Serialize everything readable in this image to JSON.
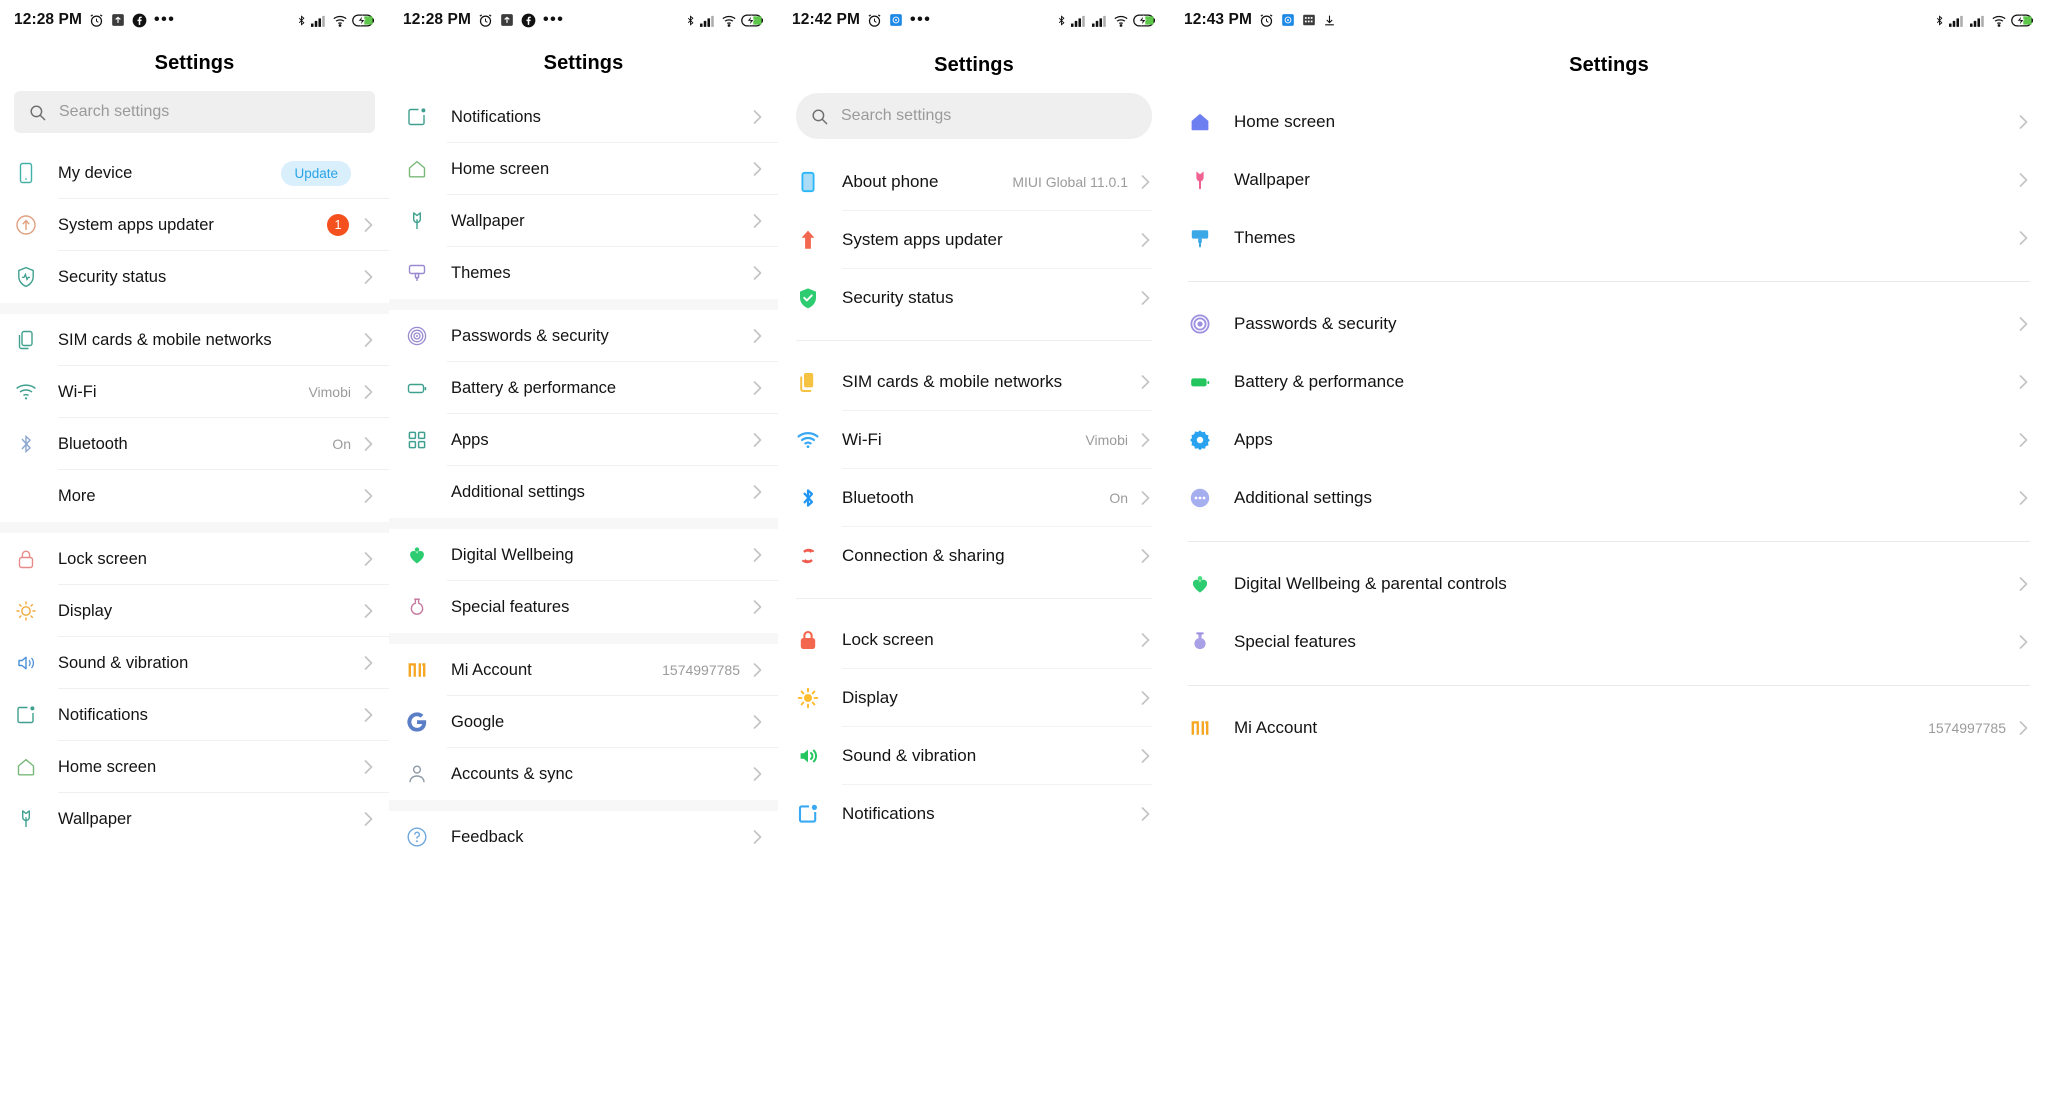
{
  "panels": [
    {
      "status": {
        "time": "12:28 PM",
        "left_icons": [
          "alarm-icon",
          "upload-box-icon",
          "facebook-icon",
          "more-dots-icon"
        ],
        "right_icons": [
          "bluetooth-icon",
          "signal-icon",
          "wifi-icon",
          "battery-charging-icon"
        ]
      },
      "title": "Settings",
      "search": {
        "placeholder": "Search settings",
        "icon": "search-icon",
        "style": "square"
      },
      "groups": [
        {
          "items": [
            {
              "label": "My device",
              "icon": "phone-outline-icon",
              "badge": "Update",
              "badge_type": "pill",
              "value": "",
              "chevron": false
            },
            {
              "label": "System apps updater",
              "icon": "update-circle-icon",
              "badge": "1",
              "badge_type": "count",
              "value": "",
              "chevron": true
            },
            {
              "label": "Security status",
              "icon": "shield-pulse-icon",
              "value": "",
              "chevron": true
            }
          ]
        },
        {
          "items": [
            {
              "label": "SIM cards & mobile networks",
              "icon": "sim-cards-icon",
              "value": "",
              "chevron": true
            },
            {
              "label": "Wi-Fi",
              "icon": "wifi-outline-icon",
              "value": "Vimobi",
              "chevron": true
            },
            {
              "label": "Bluetooth",
              "icon": "bluetooth-outline-icon",
              "value": "On",
              "chevron": true
            },
            {
              "label": "More",
              "icon": "more-dots-icon",
              "value": "",
              "chevron": true
            }
          ]
        },
        {
          "items": [
            {
              "label": "Lock screen",
              "icon": "lock-outline-icon",
              "value": "",
              "chevron": true
            },
            {
              "label": "Display",
              "icon": "display-sun-icon",
              "value": "",
              "chevron": true
            },
            {
              "label": "Sound & vibration",
              "icon": "sound-outline-icon",
              "value": "",
              "chevron": true
            },
            {
              "label": "Notifications",
              "icon": "notification-outline-icon",
              "value": "",
              "chevron": true
            },
            {
              "label": "Home screen",
              "icon": "home-outline-icon",
              "value": "",
              "chevron": true
            },
            {
              "label": "Wallpaper",
              "icon": "wallpaper-tulip-icon",
              "value": "",
              "chevron": true
            }
          ]
        }
      ]
    },
    {
      "status": {
        "time": "12:28 PM",
        "left_icons": [
          "alarm-icon",
          "upload-box-icon",
          "facebook-icon",
          "more-dots-icon"
        ],
        "right_icons": [
          "bluetooth-icon",
          "signal-icon",
          "wifi-icon",
          "battery-charging-icon"
        ]
      },
      "title": "Settings",
      "groups": [
        {
          "items": [
            {
              "label": "Notifications",
              "icon": "notification-outline-icon",
              "value": "",
              "chevron": true
            },
            {
              "label": "Home screen",
              "icon": "home-outline-icon",
              "value": "",
              "chevron": true
            },
            {
              "label": "Wallpaper",
              "icon": "wallpaper-tulip-icon",
              "value": "",
              "chevron": true
            },
            {
              "label": "Themes",
              "icon": "themes-brush-icon",
              "value": "",
              "chevron": true
            }
          ]
        },
        {
          "items": [
            {
              "label": "Passwords & security",
              "icon": "fingerprint-icon",
              "value": "",
              "chevron": true
            },
            {
              "label": "Battery & performance",
              "icon": "battery-outline-icon",
              "value": "",
              "chevron": true
            },
            {
              "label": "Apps",
              "icon": "apps-grid-icon",
              "value": "",
              "chevron": true
            },
            {
              "label": "Additional settings",
              "icon": "more-dots-icon",
              "value": "",
              "chevron": true
            }
          ]
        },
        {
          "items": [
            {
              "label": "Digital Wellbeing",
              "icon": "wellbeing-heart-icon",
              "value": "",
              "chevron": true
            },
            {
              "label": "Special features",
              "icon": "special-flask-icon",
              "value": "",
              "chevron": true
            }
          ]
        },
        {
          "items": [
            {
              "label": "Mi Account",
              "icon": "mi-logo-icon",
              "value": "1574997785",
              "chevron": true
            },
            {
              "label": "Google",
              "icon": "google-g-icon",
              "value": "",
              "chevron": true
            },
            {
              "label": "Accounts & sync",
              "icon": "account-person-icon",
              "value": "",
              "chevron": true
            }
          ]
        },
        {
          "items": [
            {
              "label": "Feedback",
              "icon": "feedback-question-icon",
              "value": "",
              "chevron": true
            }
          ]
        }
      ]
    },
    {
      "status": {
        "time": "12:42 PM",
        "left_icons": [
          "alarm-icon",
          "calendar-blue-icon",
          "more-dots-icon"
        ],
        "right_icons": [
          "bluetooth-icon",
          "signal-icon",
          "signal2-icon",
          "wifi-icon",
          "battery-charging-icon"
        ]
      },
      "title": "Settings",
      "search": {
        "placeholder": "Search settings",
        "icon": "search-icon",
        "style": "round"
      },
      "groups": [
        {
          "items": [
            {
              "label": "About phone",
              "icon": "about-phone-icon",
              "value": "MIUI Global 11.0.1",
              "chevron": true
            },
            {
              "label": "System apps updater",
              "icon": "arrow-up-red-icon",
              "value": "",
              "chevron": true
            },
            {
              "label": "Security status",
              "icon": "shield-check-green-icon",
              "value": "",
              "chevron": true
            }
          ]
        },
        {
          "items": [
            {
              "label": "SIM cards & mobile networks",
              "icon": "sim-cards-yellow-icon",
              "value": "",
              "chevron": true
            },
            {
              "label": "Wi-Fi",
              "icon": "wifi-blue-icon",
              "value": "Vimobi",
              "chevron": true
            },
            {
              "label": "Bluetooth",
              "icon": "bluetooth-blue-icon",
              "value": "On",
              "chevron": true
            },
            {
              "label": "Connection & sharing",
              "icon": "connection-share-icon",
              "value": "",
              "chevron": true
            }
          ]
        },
        {
          "items": [
            {
              "label": "Lock screen",
              "icon": "lock-red-icon",
              "value": "",
              "chevron": true
            },
            {
              "label": "Display",
              "icon": "display-sun-yellow-icon",
              "value": "",
              "chevron": true
            },
            {
              "label": "Sound & vibration",
              "icon": "sound-green-icon",
              "value": "",
              "chevron": true
            },
            {
              "label": "Notifications",
              "icon": "notification-blue-icon",
              "value": "",
              "chevron": true
            }
          ]
        }
      ]
    },
    {
      "status": {
        "time": "12:43 PM",
        "left_icons": [
          "alarm-icon",
          "calendar-blue-icon",
          "grid-icon",
          "download-icon"
        ],
        "right_icons": [
          "bluetooth-icon",
          "signal-icon",
          "signal2-icon",
          "wifi-icon",
          "battery-charging-icon"
        ]
      },
      "title": "Settings",
      "groups": [
        {
          "items": [
            {
              "label": "Home screen",
              "icon": "home-blue-icon",
              "value": "",
              "chevron": true
            },
            {
              "label": "Wallpaper",
              "icon": "wallpaper-pink-icon",
              "value": "",
              "chevron": true
            },
            {
              "label": "Themes",
              "icon": "themes-blue-icon",
              "value": "",
              "chevron": true
            }
          ]
        },
        {
          "items": [
            {
              "label": "Passwords & security",
              "icon": "fingerprint-purple-icon",
              "value": "",
              "chevron": true
            },
            {
              "label": "Battery & performance",
              "icon": "battery-green-icon",
              "value": "",
              "chevron": true
            },
            {
              "label": "Apps",
              "icon": "apps-gear-blue-icon",
              "value": "",
              "chevron": true
            },
            {
              "label": "Additional settings",
              "icon": "more-dots-purple-icon",
              "value": "",
              "chevron": true
            }
          ]
        },
        {
          "items": [
            {
              "label": "Digital Wellbeing & parental controls",
              "icon": "wellbeing-heart-green-icon",
              "value": "",
              "chevron": true
            },
            {
              "label": "Special features",
              "icon": "special-flask-purple-icon",
              "value": "",
              "chevron": true
            }
          ]
        },
        {
          "items": [
            {
              "label": "Mi Account",
              "icon": "mi-logo-icon",
              "value": "1574997785",
              "chevron": true
            }
          ]
        }
      ]
    }
  ],
  "colors": {
    "pill_bg": "#d9effc",
    "pill_text": "#2aa3e6",
    "count_badge": "#f4511e",
    "search_bg": "#efefef",
    "divider": "#f0f0f0",
    "group_gap": "#f7f7f7"
  }
}
